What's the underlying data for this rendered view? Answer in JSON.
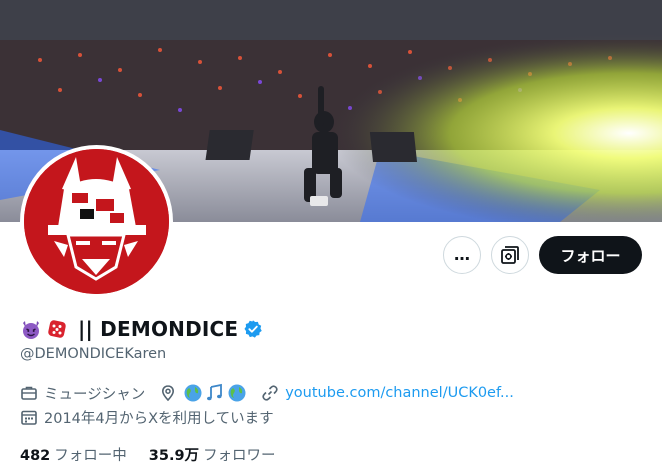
{
  "profile": {
    "display_name": "|| DEMONDICE",
    "handle": "@DEMONDICEKaren",
    "emoji_1": "smiling-devil-emoji",
    "emoji_2": "dice-emoji",
    "verified": true
  },
  "actions": {
    "more_label": "…",
    "follow_label": "フォロー"
  },
  "bio_meta": {
    "category": "ミュージシャン",
    "location_icons": [
      "globe-emoji",
      "musical-notes-emoji",
      "globe-emoji"
    ],
    "website": "youtube.com/channel/UCK0ef...",
    "joined": "2014年4月からXを利用しています"
  },
  "stats": {
    "following_count": "482",
    "following_label": "フォロー中",
    "followers_count": "35.9万",
    "followers_label": "フォロワー"
  },
  "colors": {
    "link": "#1d9bf0",
    "verified": "#1d9bf0",
    "avatar_bg": "#c4161c",
    "follow_button": "#0f1419"
  }
}
